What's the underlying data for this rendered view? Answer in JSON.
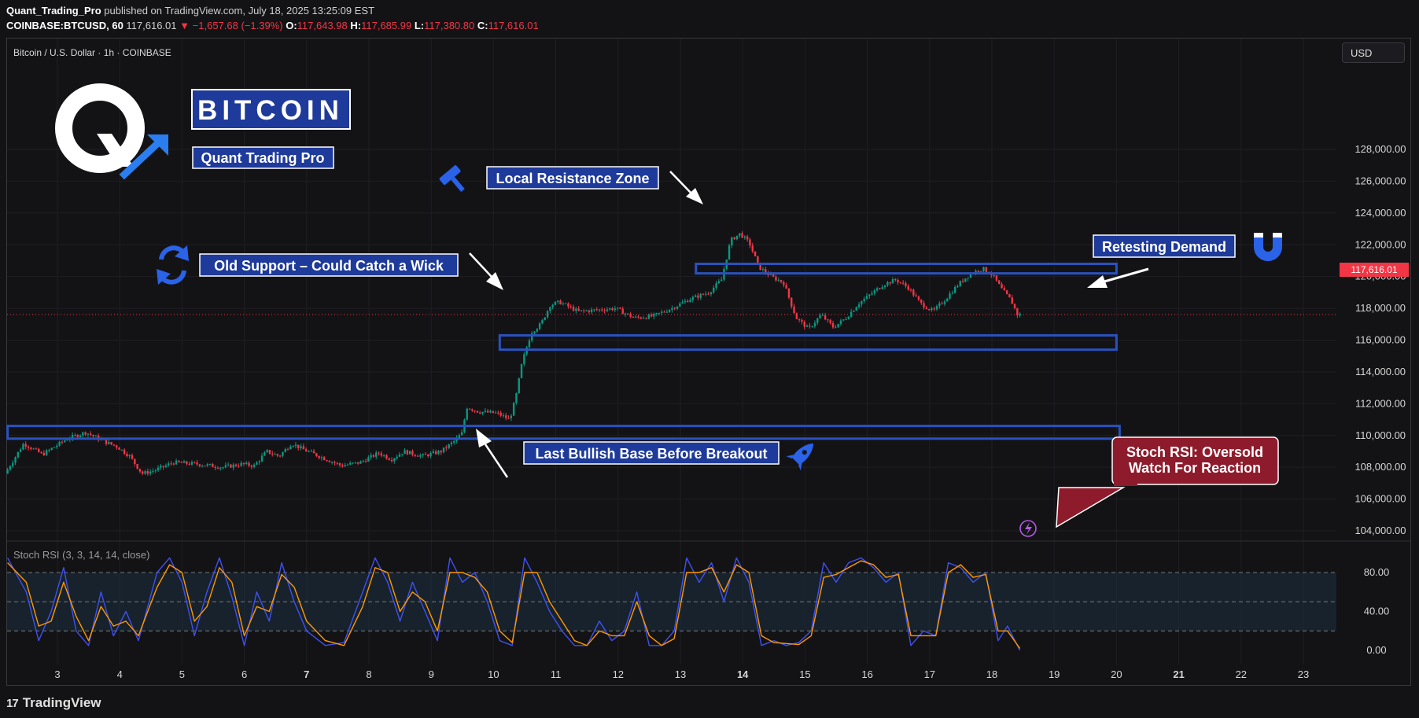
{
  "header": {
    "author": "Quant_Trading_Pro",
    "published": "published on TradingView.com, July 18, 2025 13:25:09 EST",
    "symbol": "COINBASE:BTCUSD, 60",
    "last": "117,616.01",
    "arrow": "▼",
    "change": "−1,657.68 (−1.39%)",
    "o_label": "O:",
    "o_value": "117,643.98",
    "h_label": "H:",
    "h_value": "117,685.99",
    "l_label": "L:",
    "l_value": "117,380.80",
    "c_label": "C:",
    "c_value": "117,616.01"
  },
  "pane_title": "Bitcoin / U.S. Dollar · 1h · COINBASE",
  "currency_button": "USD",
  "price_tag": "117,616.01",
  "footer": {
    "logo_text": "17",
    "brand": "TradingView"
  },
  "brand_overlay": {
    "title": "BITCOIN",
    "subtitle": "Quant Trading Pro"
  },
  "annotations": {
    "local_resistance": "Local Resistance Zone",
    "old_support": "Old Support – Could Catch a Wick",
    "retesting_demand": "Retesting Demand",
    "last_bullish_base": "Last Bullish Base Before Breakout",
    "stoch_callout_line1": "Stoch RSI: Oversold",
    "stoch_callout_line2": "Watch For Reaction"
  },
  "indicator_title": "Stoch RSI (3, 3, 14, 14, close)",
  "colors": {
    "background": "#131316",
    "up": "#089981",
    "down": "#f23645",
    "zone": "#2a52be",
    "label_bg": "#1e3a9a",
    "k_line": "#3f51f5",
    "d_line": "#ff9800",
    "callout": "#8e1b2c"
  },
  "chart_data": {
    "type": "candlestick",
    "y_ticks": [
      "128,000.00",
      "126,000.00",
      "124,000.00",
      "122,000.00",
      "120,000.00",
      "118,000.00",
      "116,000.00",
      "114,000.00",
      "112,000.00",
      "110,000.00",
      "108,000.00",
      "106,000.00",
      "104,000.00"
    ],
    "ylim": [
      103300,
      129000
    ],
    "x_ticks": [
      {
        "label": "3",
        "day": 3,
        "bold": false
      },
      {
        "label": "4",
        "day": 4,
        "bold": false
      },
      {
        "label": "5",
        "day": 5,
        "bold": false
      },
      {
        "label": "6",
        "day": 6,
        "bold": false
      },
      {
        "label": "7",
        "day": 7,
        "bold": true
      },
      {
        "label": "8",
        "day": 8,
        "bold": false
      },
      {
        "label": "9",
        "day": 9,
        "bold": false
      },
      {
        "label": "10",
        "day": 10,
        "bold": false
      },
      {
        "label": "11",
        "day": 11,
        "bold": false
      },
      {
        "label": "12",
        "day": 12,
        "bold": false
      },
      {
        "label": "13",
        "day": 13,
        "bold": false
      },
      {
        "label": "14",
        "day": 14,
        "bold": true
      },
      {
        "label": "15",
        "day": 15,
        "bold": false
      },
      {
        "label": "16",
        "day": 16,
        "bold": false
      },
      {
        "label": "17",
        "day": 17,
        "bold": false
      },
      {
        "label": "18",
        "day": 18,
        "bold": false
      },
      {
        "label": "19",
        "day": 19,
        "bold": false
      },
      {
        "label": "20",
        "day": 20,
        "bold": false
      },
      {
        "label": "21",
        "day": 21,
        "bold": true
      },
      {
        "label": "22",
        "day": 22,
        "bold": false
      },
      {
        "label": "23",
        "day": 23,
        "bold": false
      }
    ],
    "price_path": [
      [
        2.2,
        107600
      ],
      [
        2.5,
        109500
      ],
      [
        2.8,
        108800
      ],
      [
        3.2,
        109800
      ],
      [
        3.5,
        110200
      ],
      [
        3.8,
        109600
      ],
      [
        4.0,
        109300
      ],
      [
        4.2,
        108700
      ],
      [
        4.4,
        107600
      ],
      [
        4.6,
        107800
      ],
      [
        4.9,
        108300
      ],
      [
        5.3,
        108200
      ],
      [
        5.7,
        108000
      ],
      [
        6.0,
        108200
      ],
      [
        6.2,
        108100
      ],
      [
        6.4,
        109000
      ],
      [
        6.6,
        108700
      ],
      [
        6.8,
        109500
      ],
      [
        7.0,
        109100
      ],
      [
        7.3,
        108600
      ],
      [
        7.6,
        108100
      ],
      [
        7.9,
        108300
      ],
      [
        8.2,
        108900
      ],
      [
        8.4,
        108500
      ],
      [
        8.6,
        109000
      ],
      [
        8.9,
        108700
      ],
      [
        9.2,
        109000
      ],
      [
        9.4,
        109600
      ],
      [
        9.55,
        110200
      ],
      [
        9.6,
        111800
      ],
      [
        9.8,
        111500
      ],
      [
        10.1,
        111400
      ],
      [
        10.3,
        111000
      ],
      [
        10.4,
        112400
      ],
      [
        10.5,
        114600
      ],
      [
        10.65,
        116500
      ],
      [
        10.8,
        117000
      ],
      [
        10.95,
        118200
      ],
      [
        11.1,
        118400
      ],
      [
        11.4,
        117800
      ],
      [
        11.7,
        117900
      ],
      [
        12.0,
        118000
      ],
      [
        12.3,
        117400
      ],
      [
        12.6,
        117500
      ],
      [
        12.9,
        118000
      ],
      [
        13.2,
        118600
      ],
      [
        13.5,
        119000
      ],
      [
        13.7,
        119800
      ],
      [
        13.85,
        122300
      ],
      [
        14.0,
        122700
      ],
      [
        14.15,
        122100
      ],
      [
        14.3,
        120600
      ],
      [
        14.5,
        120000
      ],
      [
        14.7,
        119600
      ],
      [
        14.9,
        117400
      ],
      [
        15.1,
        116700
      ],
      [
        15.3,
        117600
      ],
      [
        15.5,
        116800
      ],
      [
        15.7,
        117400
      ],
      [
        15.9,
        118300
      ],
      [
        16.1,
        118900
      ],
      [
        16.3,
        119500
      ],
      [
        16.5,
        119800
      ],
      [
        16.7,
        119300
      ],
      [
        16.9,
        118300
      ],
      [
        17.1,
        117800
      ],
      [
        17.3,
        118600
      ],
      [
        17.5,
        119500
      ],
      [
        17.7,
        120200
      ],
      [
        17.9,
        120500
      ],
      [
        18.05,
        120100
      ],
      [
        18.2,
        119200
      ],
      [
        18.35,
        118500
      ],
      [
        18.45,
        117616
      ]
    ],
    "zones": [
      {
        "from_day": 13.25,
        "to_day": 20.0,
        "low": 120200,
        "high": 120800
      },
      {
        "from_day": 10.1,
        "to_day": 20.0,
        "low": 115400,
        "high": 116300
      },
      {
        "from_day": 2.2,
        "to_day": 20.05,
        "low": 109800,
        "high": 110600
      }
    ],
    "stoch_rsi": {
      "name": "Stoch RSI (3, 3, 14, 14, close)",
      "levels": [
        80,
        50,
        20
      ],
      "y_ticks": [
        "80.00",
        "40.00",
        "0.00"
      ],
      "ylim": [
        0,
        100
      ],
      "k": [
        [
          2.2,
          95
        ],
        [
          2.5,
          60
        ],
        [
          2.7,
          10
        ],
        [
          2.9,
          40
        ],
        [
          3.1,
          85
        ],
        [
          3.3,
          20
        ],
        [
          3.5,
          5
        ],
        [
          3.7,
          60
        ],
        [
          3.9,
          15
        ],
        [
          4.1,
          40
        ],
        [
          4.3,
          10
        ],
        [
          4.6,
          80
        ],
        [
          4.8,
          95
        ],
        [
          5.0,
          70
        ],
        [
          5.2,
          15
        ],
        [
          5.4,
          60
        ],
        [
          5.6,
          95
        ],
        [
          5.8,
          55
        ],
        [
          6.0,
          5
        ],
        [
          6.2,
          60
        ],
        [
          6.4,
          30
        ],
        [
          6.6,
          90
        ],
        [
          6.8,
          50
        ],
        [
          7.0,
          20
        ],
        [
          7.3,
          5
        ],
        [
          7.6,
          8
        ],
        [
          7.9,
          60
        ],
        [
          8.1,
          95
        ],
        [
          8.3,
          70
        ],
        [
          8.5,
          30
        ],
        [
          8.7,
          70
        ],
        [
          8.9,
          40
        ],
        [
          9.1,
          10
        ],
        [
          9.3,
          95
        ],
        [
          9.5,
          70
        ],
        [
          9.7,
          80
        ],
        [
          9.9,
          50
        ],
        [
          10.1,
          10
        ],
        [
          10.3,
          5
        ],
        [
          10.5,
          95
        ],
        [
          10.7,
          70
        ],
        [
          10.9,
          40
        ],
        [
          11.1,
          20
        ],
        [
          11.3,
          5
        ],
        [
          11.5,
          5
        ],
        [
          11.7,
          30
        ],
        [
          11.9,
          10
        ],
        [
          12.1,
          20
        ],
        [
          12.3,
          60
        ],
        [
          12.5,
          5
        ],
        [
          12.7,
          5
        ],
        [
          12.9,
          20
        ],
        [
          13.1,
          95
        ],
        [
          13.3,
          70
        ],
        [
          13.5,
          90
        ],
        [
          13.7,
          50
        ],
        [
          13.9,
          95
        ],
        [
          14.1,
          70
        ],
        [
          14.3,
          5
        ],
        [
          14.5,
          10
        ],
        [
          14.7,
          5
        ],
        [
          14.9,
          8
        ],
        [
          15.1,
          20
        ],
        [
          15.3,
          90
        ],
        [
          15.5,
          70
        ],
        [
          15.7,
          90
        ],
        [
          15.9,
          95
        ],
        [
          16.1,
          85
        ],
        [
          16.3,
          70
        ],
        [
          16.5,
          80
        ],
        [
          16.7,
          5
        ],
        [
          16.9,
          20
        ],
        [
          17.1,
          15
        ],
        [
          17.3,
          90
        ],
        [
          17.5,
          85
        ],
        [
          17.7,
          70
        ],
        [
          17.9,
          80
        ],
        [
          18.1,
          10
        ],
        [
          18.25,
          25
        ],
        [
          18.45,
          0
        ]
      ],
      "d": [
        [
          2.2,
          90
        ],
        [
          2.5,
          70
        ],
        [
          2.7,
          25
        ],
        [
          2.9,
          30
        ],
        [
          3.1,
          70
        ],
        [
          3.3,
          35
        ],
        [
          3.5,
          10
        ],
        [
          3.7,
          45
        ],
        [
          3.9,
          25
        ],
        [
          4.1,
          30
        ],
        [
          4.3,
          15
        ],
        [
          4.6,
          65
        ],
        [
          4.8,
          88
        ],
        [
          5.0,
          80
        ],
        [
          5.2,
          30
        ],
        [
          5.4,
          45
        ],
        [
          5.6,
          85
        ],
        [
          5.8,
          70
        ],
        [
          6.0,
          15
        ],
        [
          6.2,
          45
        ],
        [
          6.4,
          40
        ],
        [
          6.6,
          78
        ],
        [
          6.8,
          65
        ],
        [
          7.0,
          30
        ],
        [
          7.3,
          10
        ],
        [
          7.6,
          5
        ],
        [
          7.9,
          45
        ],
        [
          8.1,
          85
        ],
        [
          8.3,
          80
        ],
        [
          8.5,
          40
        ],
        [
          8.7,
          60
        ],
        [
          8.9,
          50
        ],
        [
          9.1,
          20
        ],
        [
          9.3,
          80
        ],
        [
          9.5,
          80
        ],
        [
          9.7,
          75
        ],
        [
          9.9,
          60
        ],
        [
          10.1,
          20
        ],
        [
          10.3,
          8
        ],
        [
          10.5,
          80
        ],
        [
          10.7,
          80
        ],
        [
          10.9,
          50
        ],
        [
          11.1,
          30
        ],
        [
          11.3,
          10
        ],
        [
          11.5,
          5
        ],
        [
          11.7,
          20
        ],
        [
          11.9,
          15
        ],
        [
          12.1,
          15
        ],
        [
          12.3,
          50
        ],
        [
          12.5,
          15
        ],
        [
          12.7,
          5
        ],
        [
          12.9,
          12
        ],
        [
          13.1,
          80
        ],
        [
          13.3,
          80
        ],
        [
          13.5,
          85
        ],
        [
          13.7,
          60
        ],
        [
          13.9,
          88
        ],
        [
          14.1,
          80
        ],
        [
          14.3,
          15
        ],
        [
          14.5,
          8
        ],
        [
          14.7,
          7
        ],
        [
          14.9,
          6
        ],
        [
          15.1,
          15
        ],
        [
          15.3,
          75
        ],
        [
          15.5,
          78
        ],
        [
          15.7,
          85
        ],
        [
          15.9,
          92
        ],
        [
          16.1,
          88
        ],
        [
          16.3,
          75
        ],
        [
          16.5,
          78
        ],
        [
          16.7,
          15
        ],
        [
          16.9,
          15
        ],
        [
          17.1,
          15
        ],
        [
          17.3,
          80
        ],
        [
          17.5,
          88
        ],
        [
          17.7,
          75
        ],
        [
          17.9,
          78
        ],
        [
          18.1,
          20
        ],
        [
          18.25,
          20
        ],
        [
          18.45,
          2
        ]
      ]
    }
  }
}
